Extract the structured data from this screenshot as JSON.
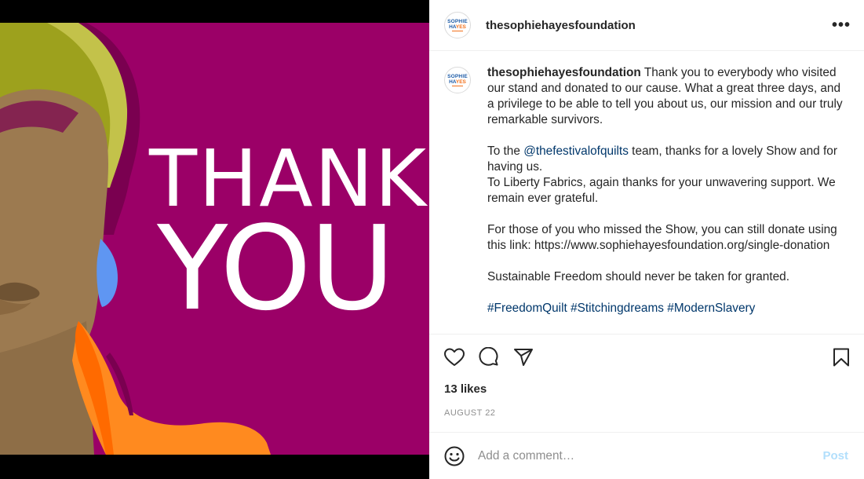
{
  "post": {
    "username": "thesophiehayesfoundation",
    "avatar": {
      "line1": "SOPHIE",
      "line2_a": "HA",
      "line2_b": "YES"
    },
    "image": {
      "line1": "THANK",
      "line2": "YOU"
    },
    "caption": {
      "username": "thesophiehayesfoundation",
      "p1": " Thank you to everybody who visited our stand and donated to our cause. What a great three days, and a privilege to be able to tell you about us, our mission and our truly remarkable survivors.",
      "p2_pre": "To the ",
      "p2_mention": "@thefestivalofquilts",
      "p2_post": " team, thanks for a lovely Show and for having us.",
      "p3": "To Liberty Fabrics, again thanks for your unwavering support. We remain ever grateful.",
      "p4": "For those of you who missed the Show, you can still donate using this link: https://www.sophiehayesfoundation.org/single-donation",
      "p5": "Sustainable Freedom should never be taken for granted.",
      "hashtags": [
        "#FreedomQuilt",
        "#Stitchingdreams",
        "#ModernSlavery"
      ]
    },
    "likes": "13 likes",
    "date": "AUGUST 22",
    "comment": {
      "placeholder": "Add a comment…",
      "post_label": "Post"
    },
    "icons": {
      "like": "heart-icon",
      "comment": "comment-icon",
      "share": "share-icon",
      "save": "bookmark-icon",
      "more": "more-options-icon",
      "emoji": "emoji-icon"
    },
    "colors": {
      "background_magenta": "#9b0067",
      "link": "#00376b",
      "post_disabled": "#b2dffc",
      "muted": "#8e8e8e"
    }
  }
}
